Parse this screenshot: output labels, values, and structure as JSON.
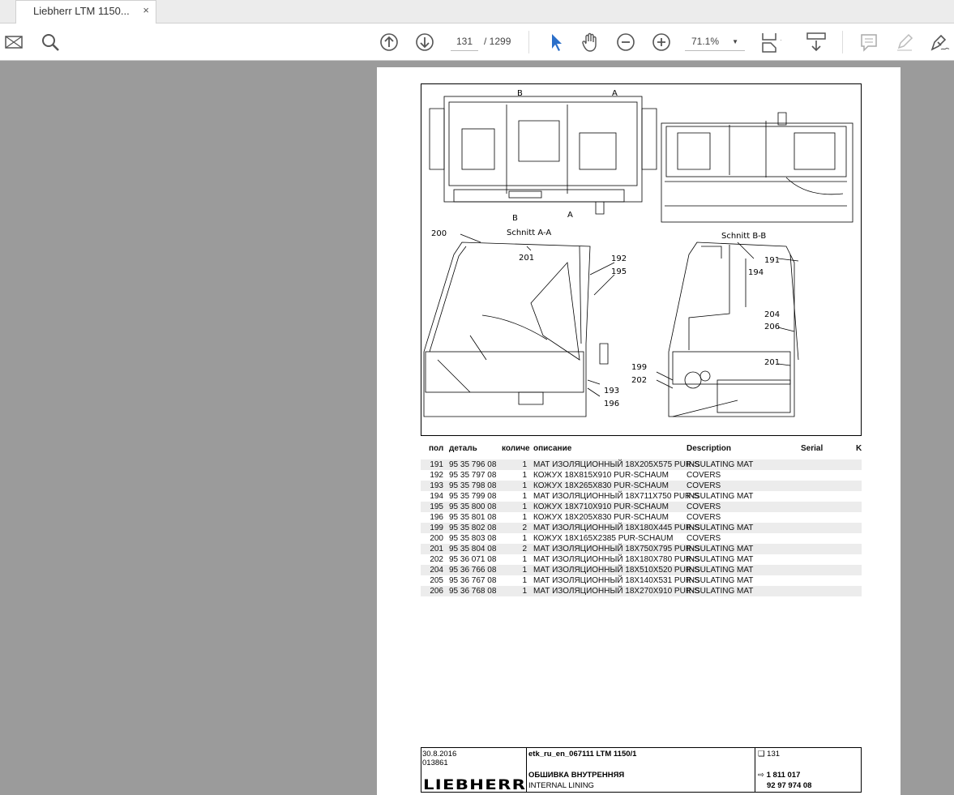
{
  "tab": {
    "title": "Liebherr LTM 1150...",
    "close": "×"
  },
  "toolbar": {
    "page_current": "131",
    "page_total": "/ 1299",
    "zoom": "71.1%"
  },
  "drawing": {
    "labels": {
      "b_top": "B",
      "a_top": "A",
      "b_bot": "B",
      "a_bot": "A",
      "section_aa": "Schnitt A-A",
      "section_bb": "Schnitt B-B",
      "l200": "200",
      "l201a": "201",
      "l192": "192",
      "l195": "195",
      "l193": "193",
      "l196": "196",
      "l191": "191",
      "l194": "194",
      "l204": "204",
      "l206": "206",
      "l201b": "201",
      "l199": "199",
      "l202": "202"
    }
  },
  "table": {
    "headers": [
      "пол",
      "деталь",
      "количе",
      "описание",
      "Description",
      "Serial",
      "K"
    ],
    "rows": [
      [
        "191",
        "95 35 796 08",
        "1",
        "МАТ ИЗОЛЯЦИОННЫЙ 18X205X575 PUR-S",
        "INSULATING MAT"
      ],
      [
        "192",
        "95 35 797 08",
        "1",
        "КОЖУХ 18X815X910 PUR-SCHAUM",
        "COVERS"
      ],
      [
        "193",
        "95 35 798 08",
        "1",
        "КОЖУХ 18X265X830 PUR-SCHAUM",
        "COVERS"
      ],
      [
        "194",
        "95 35 799 08",
        "1",
        "МАТ ИЗОЛЯЦИОННЫЙ 18X711X750 PUR-S",
        "INSULATING MAT"
      ],
      [
        "195",
        "95 35 800 08",
        "1",
        "КОЖУХ 18X710X910 PUR-SCHAUM",
        "COVERS"
      ],
      [
        "196",
        "95 35 801 08",
        "1",
        "КОЖУХ 18X205X830 PUR-SCHAUM",
        "COVERS"
      ],
      [
        "199",
        "95 35 802 08",
        "2",
        "МАТ ИЗОЛЯЦИОННЫЙ 18X180X445 PUR-S",
        "INSULATING MAT"
      ],
      [
        "200",
        "95 35 803 08",
        "1",
        "КОЖУХ 18X165X2385 PUR-SCHAUM",
        "COVERS"
      ],
      [
        "201",
        "95 35 804 08",
        "2",
        "МАТ ИЗОЛЯЦИОННЫЙ 18X750X795 PUR-S",
        "INSULATING MAT"
      ],
      [
        "202",
        "95 36 071 08",
        "1",
        "МАТ ИЗОЛЯЦИОННЫЙ 18X180X780 PUR-S",
        "INSULATING MAT"
      ],
      [
        "204",
        "95 36 766 08",
        "1",
        "МАТ ИЗОЛЯЦИОННЫЙ 18X510X520 PUR-S",
        "INSULATING MAT"
      ],
      [
        "205",
        "95 36 767 08",
        "1",
        "МАТ ИЗОЛЯЦИОННЫЙ 18X140X531 PUR-S",
        "INSULATING MAT"
      ],
      [
        "206",
        "95 36 768 08",
        "1",
        "МАТ ИЗОЛЯЦИОННЫЙ 18X270X910 PUR-S",
        "INSULATING MAT"
      ]
    ]
  },
  "footer": {
    "date": "30.8.2016",
    "code": "013861",
    "logo": "LIEBHERR",
    "doc": "etk_ru_en_067111 LTM 1150/1",
    "title_ru": "ОБШИВКА ВНУТРЕННЯЯ",
    "title_en": "INTERNAL LINING",
    "page": "131",
    "ref1": "1 811 017",
    "ref2": "92 97 974 08"
  }
}
